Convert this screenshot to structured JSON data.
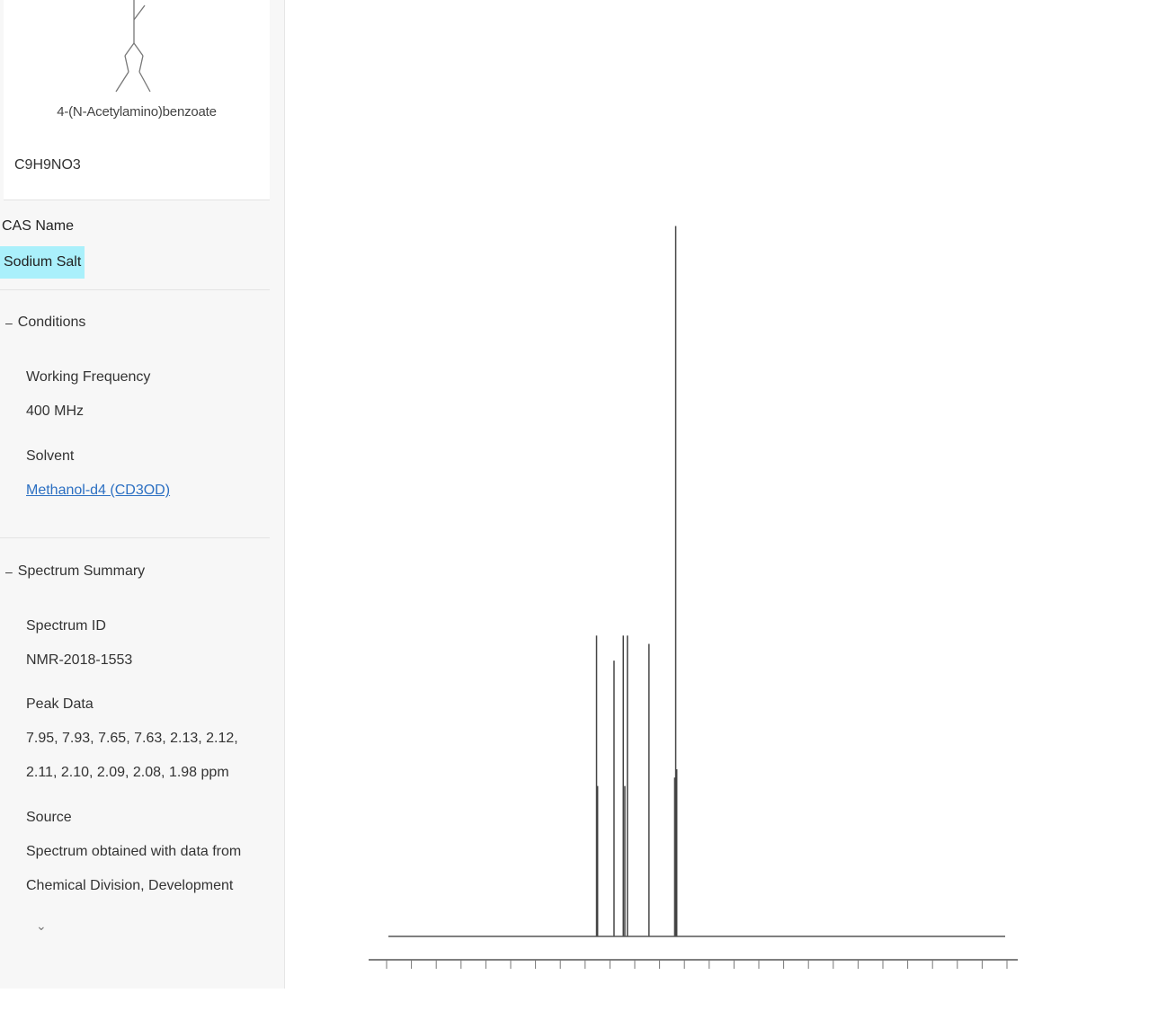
{
  "structure": {
    "compound_name": "4-(N-Acetylamino)benzoate",
    "formula": "C9H9NO3"
  },
  "cas": {
    "label": "CAS Name",
    "value": "Sodium Salt"
  },
  "conditions": {
    "header": "Conditions",
    "toggle_icon": "minus-icon",
    "frequency_label": "Working Frequency",
    "frequency_value": "400 MHz",
    "solvent_label": "Solvent",
    "solvent_value": "Methanol-d4 (CD3OD)"
  },
  "summary": {
    "header": "Spectrum Summary",
    "toggle_icon": "minus-icon",
    "spectrum_id_label": "Spectrum ID",
    "spectrum_id_value": "NMR-2018-1553",
    "peak_label": "Peak Data",
    "peak_value_1": "7.95, 7.93, 7.65, 7.63, 2.13, 2.12,",
    "peak_value_2": "2.11, 2.10, 2.09, 2.08, 1.98 ppm",
    "source_label": "Source",
    "source_value_1": "Spectrum obtained with data from",
    "source_value_2": "Chemical Division, Development",
    "more_icon": "chevron-down-icon"
  },
  "chart_data": {
    "type": "line",
    "x_axis": {
      "reversed": true,
      "range": [
        12,
        0
      ],
      "tick_labels": []
    },
    "baseline": 0,
    "peaks": [
      {
        "ppm": 7.95,
        "intensity": 0.36
      },
      {
        "ppm": 7.93,
        "intensity": 0.18
      },
      {
        "ppm": 7.61,
        "intensity": 0.33
      },
      {
        "ppm": 7.43,
        "intensity": 0.36
      },
      {
        "ppm": 7.4,
        "intensity": 0.18
      },
      {
        "ppm": 7.35,
        "intensity": 0.36
      },
      {
        "ppm": 6.93,
        "intensity": 0.35
      },
      {
        "ppm": 6.43,
        "intensity": 0.19
      },
      {
        "ppm": 6.41,
        "intensity": 0.85
      },
      {
        "ppm": 6.39,
        "intensity": 0.2
      }
    ]
  }
}
